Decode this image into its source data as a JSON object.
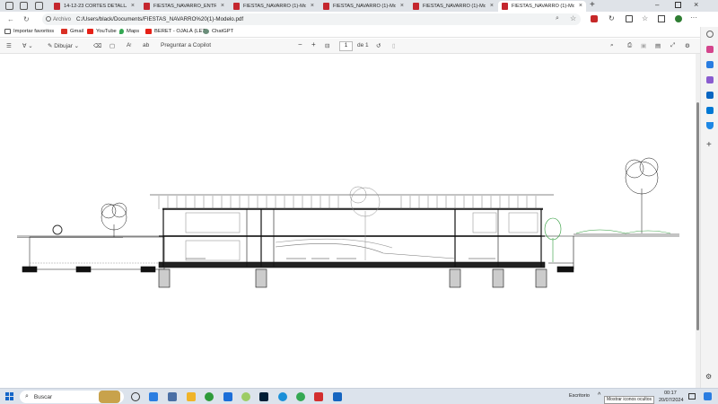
{
  "browser": {
    "tabs": [
      {
        "title": "14-12-23 CORTES DETALLADO..."
      },
      {
        "title": "FIESTAS_NAVARRO_ENTREGA_FI..."
      },
      {
        "title": "FIESTAS_NAVARRO (1)-Modelo.p..."
      },
      {
        "title": "FIESTAS_NAVARRO (1)-Modelo.p..."
      },
      {
        "title": "FIESTAS_NAVARRO (1)-Modelo.p..."
      },
      {
        "title": "FIESTAS_NAVARRO (1)-Modelo.p..."
      }
    ],
    "active_tab_index": 5,
    "address_mode": "Archivo",
    "url": "C:/Users/black/Documents/FIESTAS_NAVARRO%20(1)-Modelo.pdf"
  },
  "favorites": [
    {
      "label": "Importar favoritos",
      "icon": "import-icon"
    },
    {
      "label": "Gmail",
      "icon": "gmail-icon"
    },
    {
      "label": "YouTube",
      "icon": "youtube-icon"
    },
    {
      "label": "Maps",
      "icon": "maps-icon"
    },
    {
      "label": "BERET - OJALÁ (LET...",
      "icon": "youtube-icon"
    },
    {
      "label": "ChatGPT",
      "icon": "chatgpt-icon"
    }
  ],
  "pdf_toolbar": {
    "draw_label": "Dibujar",
    "copilot_label": "Preguntar a Copilot",
    "page_current": "1",
    "page_total": "de 1"
  },
  "taskbar": {
    "search_placeholder": "Buscar",
    "desktop_label": "Escritorio",
    "time": "00:17",
    "date": "20/07/2024",
    "tooltip": "Mostrar iconos ocultos"
  }
}
